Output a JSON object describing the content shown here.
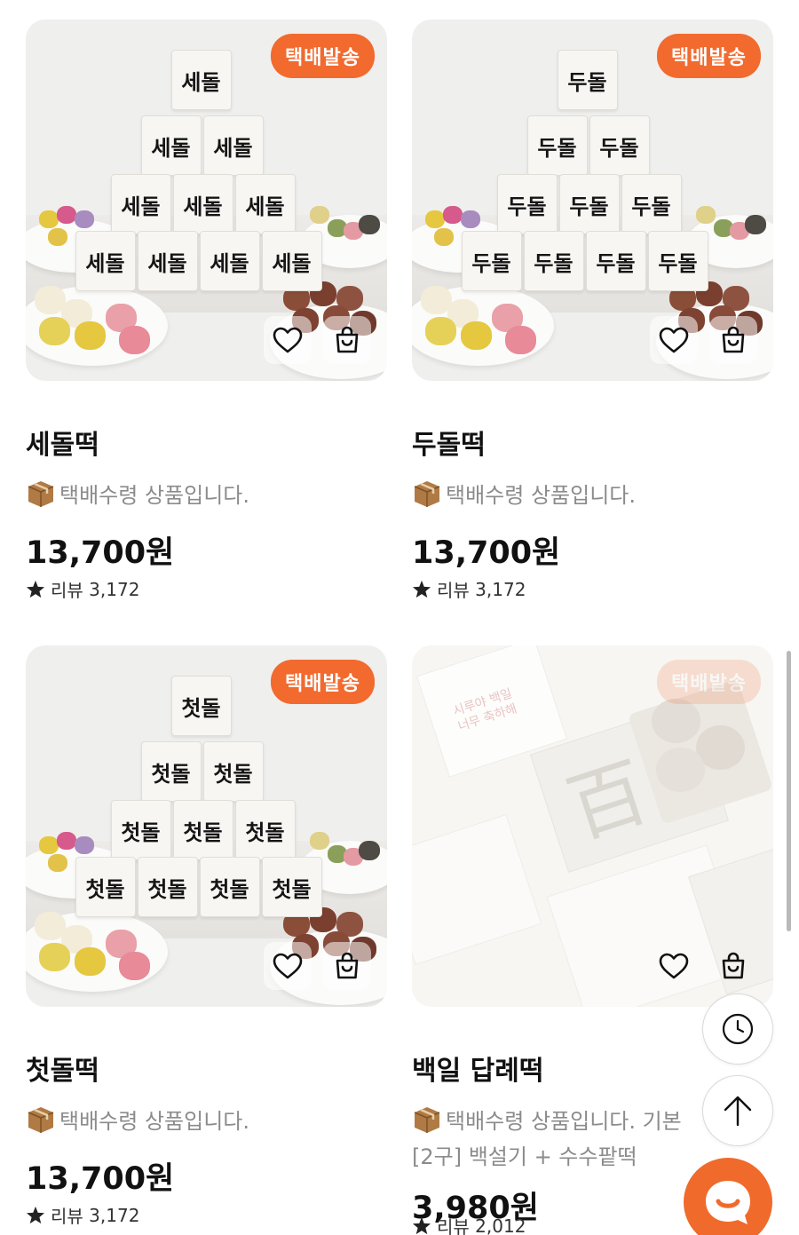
{
  "products": [
    {
      "name": "세돌떡",
      "badge": "택배발송",
      "block_text": "세돌",
      "desc": "택배수령 상품입니다.",
      "price": "13,700원",
      "review_label": "리뷰",
      "review_count": "3,172"
    },
    {
      "name": "두돌떡",
      "badge": "택배발송",
      "block_text": "두돌",
      "desc": "택배수령 상품입니다.",
      "price": "13,700원",
      "review_label": "리뷰",
      "review_count": "3,172"
    },
    {
      "name": "첫돌떡",
      "badge": "택배발송",
      "block_text": "첫돌",
      "desc": "택배수령 상품입니다.",
      "price": "13,700원",
      "review_label": "리뷰",
      "review_count": "3,172"
    },
    {
      "name": "백일 답례떡",
      "badge": "택배발송",
      "image_text": {
        "hundred": "百",
        "sticker_line1": "시루야 백일",
        "sticker_line2": "너무 축하해"
      },
      "desc": "택배수령 상품입니다. 기본",
      "desc_line2": "[2구] 백설기 + 수수팥떡",
      "price": "3,980원",
      "review_label": "리뷰",
      "review_count": "2,012"
    }
  ],
  "icons": {
    "wishlist": "heart-icon",
    "cart": "shopping-bag-icon",
    "recent": "clock-icon",
    "top": "arrow-up-icon",
    "chat": "chat-icon",
    "rating": "star-icon",
    "delivery": "box-icon"
  },
  "colors": {
    "badge": "#f26a2e",
    "chat_button": "#f06a2b",
    "desc_text": "#8b8b8b"
  }
}
